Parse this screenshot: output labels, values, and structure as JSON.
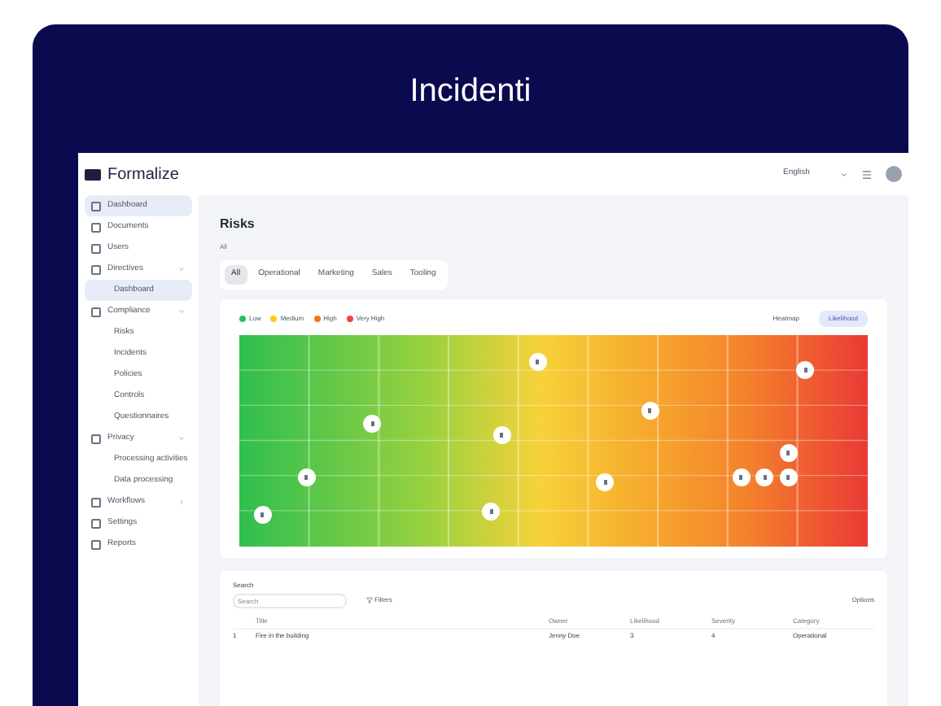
{
  "card": {
    "title": "Incidenti"
  },
  "app": {
    "logo": "Formalize",
    "topbar": {
      "language": "English"
    },
    "sidebar": [
      {
        "label": "Dashboard",
        "selected": true
      },
      {
        "label": "Documents",
        "selected": false
      },
      {
        "label": "Users",
        "selected": false
      },
      {
        "label": "Directives",
        "selected": false,
        "expanded": true,
        "children": [
          {
            "label": "Dashboard",
            "selected": true
          }
        ]
      },
      {
        "label": "Compliance",
        "selected": false,
        "expanded": true,
        "children": [
          {
            "label": "Risks",
            "selected": false
          },
          {
            "label": "Incidents",
            "selected": false
          },
          {
            "label": "Policies",
            "selected": false
          },
          {
            "label": "Controls",
            "selected": false
          },
          {
            "label": "Questionnaires",
            "selected": false
          }
        ]
      },
      {
        "label": "Privacy",
        "selected": false,
        "expanded": true,
        "children": [
          {
            "label": "Processing activities",
            "selected": false
          },
          {
            "label": "Data processing",
            "selected": false
          }
        ]
      },
      {
        "label": "Workflows",
        "selected": false,
        "expanded": false
      },
      {
        "label": "Settings",
        "selected": false
      },
      {
        "label": "Reports",
        "selected": false
      }
    ],
    "page_title": "Risks",
    "subtitle": "All",
    "tabs": [
      {
        "label": "All",
        "selected": true
      },
      {
        "label": "Operational",
        "selected": false
      },
      {
        "label": "Marketing",
        "selected": false
      },
      {
        "label": "Sales",
        "selected": false
      },
      {
        "label": "Tooling",
        "selected": false
      }
    ],
    "legend": [
      {
        "label": "Low",
        "color": "#22c55e"
      },
      {
        "label": "Medium",
        "color": "#facc15"
      },
      {
        "label": "High",
        "color": "#f97316"
      },
      {
        "label": "Very High",
        "color": "#ef4444"
      }
    ],
    "view_buttons": [
      {
        "label": "Heatmap",
        "selected": false
      },
      {
        "label": "Likelihood",
        "selected": true
      }
    ],
    "search": {
      "label": "Search",
      "placeholder": "Search"
    },
    "filters_button": "Filters",
    "options_button": "Options",
    "table": {
      "columns": [
        "Title",
        "Owner",
        "Likelihood",
        "Severity",
        "Category"
      ],
      "rows": [
        {
          "number": "1",
          "cells": [
            "Fire in the building",
            "Jenny Doe",
            "3",
            "4",
            "Operational"
          ]
        }
      ]
    }
  }
}
